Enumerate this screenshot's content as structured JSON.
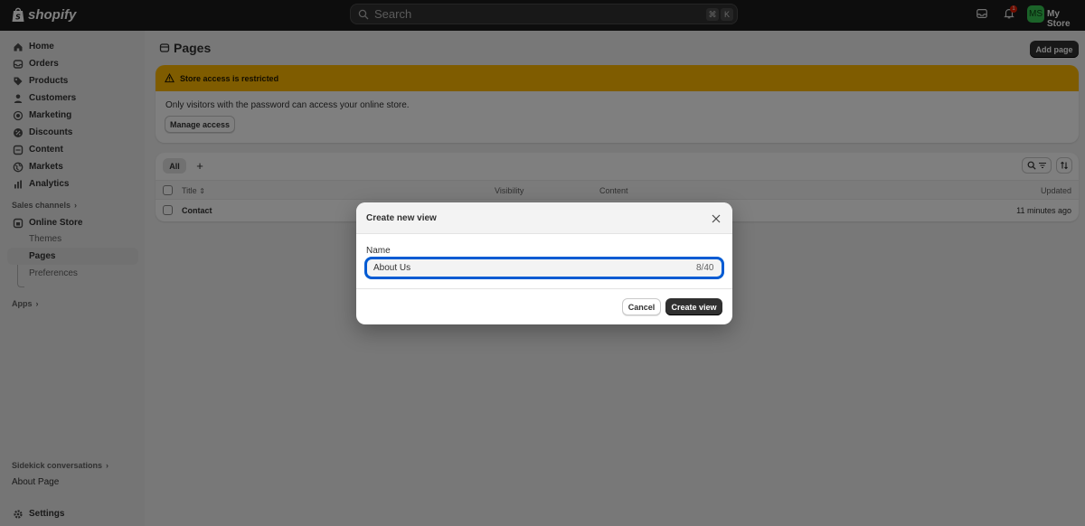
{
  "topbar": {
    "logo_text": "shopify",
    "search_placeholder": "Search",
    "kbd_cmd": "⌘",
    "kbd_k": "K",
    "notification_count": "1",
    "avatar_initials": "MS",
    "store_name": "My Store"
  },
  "sidebar": {
    "items": [
      {
        "label": "Home",
        "icon": "home-icon"
      },
      {
        "label": "Orders",
        "icon": "orders-icon"
      },
      {
        "label": "Products",
        "icon": "tag-icon"
      },
      {
        "label": "Customers",
        "icon": "person-icon"
      },
      {
        "label": "Marketing",
        "icon": "target-icon"
      },
      {
        "label": "Discounts",
        "icon": "discount-icon"
      },
      {
        "label": "Content",
        "icon": "content-icon"
      },
      {
        "label": "Markets",
        "icon": "globe-icon"
      },
      {
        "label": "Analytics",
        "icon": "chart-icon"
      }
    ],
    "sales_channels_label": "Sales channels",
    "online_store_label": "Online Store",
    "sub_items": [
      "Themes",
      "Pages",
      "Preferences"
    ],
    "apps_label": "Apps",
    "sidekick_label": "Sidekick conversations",
    "about_page_label": "About Page",
    "settings_label": "Settings"
  },
  "main": {
    "page_title": "Pages",
    "add_page_label": "Add page",
    "banner": {
      "title": "Store access is restricted",
      "text": "Only visitors with the password can access your online store.",
      "button": "Manage access"
    },
    "table": {
      "tab_all": "All",
      "tab_add": "+",
      "columns": {
        "title": "Title",
        "visibility": "Visibility",
        "content": "Content",
        "updated": "Updated"
      },
      "rows": [
        {
          "title": "Contact",
          "updated": "11 minutes ago"
        }
      ]
    }
  },
  "modal": {
    "title": "Create new view",
    "name_label": "Name",
    "name_value": "About Us",
    "char_count": "8/40",
    "cancel_label": "Cancel",
    "create_label": "Create view"
  },
  "colors": {
    "topbar": "#1a1a1a",
    "banner_warning": "#ffb800",
    "primary_button": "#303030",
    "focus_ring": "#005bd3",
    "avatar": "#36c752"
  }
}
